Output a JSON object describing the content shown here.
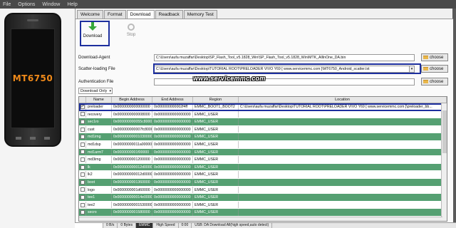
{
  "menu": [
    "File",
    "Options",
    "Window",
    "Help"
  ],
  "device_chip": "MT6750",
  "tabs": [
    "Welcome",
    "Format",
    "Download",
    "Readback",
    "Memory Test"
  ],
  "toolbar": {
    "download_label": "Download",
    "stop_label": "Stop"
  },
  "fields": {
    "download_agent_label": "Download-Agent",
    "download_agent_value": "C:\\Users\\aufa muzaffar\\Desktop\\SP_Flash_Tool_v5.1828_Win\\SP_Flash_Tool_v5.1828_Win\\MTK_AllInOne_DA.bin",
    "scatter_label": "Scatter-loading File",
    "scatter_value": "C:\\Users\\aufa muzaffar\\Desktop\\TUTORIAL ROOT\\PRELOADER VIVO Y69 [ www.servicemmc.com ]\\MT6750_Android_scatter.txt",
    "auth_label": "Authentication File",
    "auth_value": "",
    "choose": "choose"
  },
  "watermark": "www.servicemmc.com",
  "mode": "Download Only",
  "table": {
    "headers": [
      "",
      "Name",
      "Begin Address",
      "End Address",
      "Region",
      "Location"
    ],
    "rows": [
      {
        "checked": true,
        "name": "preloader",
        "begin": "0x0000000000000000",
        "end": "0x000000000002f4ff",
        "region": "EMMC_BOOT1_BOOT2",
        "location": "C:\\Users\\aufa muzaffar\\Desktop\\TUTORIAL ROOT\\PRELOADER VIVO Y69 [ www.servicemmc.com ]\\preloader_bb..."
      },
      {
        "checked": false,
        "name": "recovery",
        "begin": "0x0000000000008000",
        "end": "0x0000000000000000",
        "region": "EMMC_USER",
        "location": ""
      },
      {
        "checked": false,
        "name": "sec1ro",
        "begin": "0x000000000055c8000",
        "end": "0x0000000000000000",
        "region": "EMMC_USER",
        "location": ""
      },
      {
        "checked": false,
        "name": "cust",
        "begin": "0x000000000007fc8000",
        "end": "0x0000000000000000",
        "region": "EMMC_USER",
        "location": ""
      },
      {
        "checked": false,
        "name": "md1img",
        "begin": "0x0000000000103000000",
        "end": "0x0000000000000000",
        "region": "EMMC_USER",
        "location": ""
      },
      {
        "checked": false,
        "name": "md1dsp",
        "begin": "0x00000000011a00000",
        "end": "0x0000000000000000",
        "region": "EMMC_USER",
        "location": ""
      },
      {
        "checked": false,
        "name": "md1arm7",
        "begin": "0x0000000001f00000",
        "end": "0x0000000000000000",
        "region": "EMMC_USER",
        "location": ""
      },
      {
        "checked": false,
        "name": "md3img",
        "begin": "0x0000000001200000",
        "end": "0x0000000000000000",
        "region": "EMMC_USER",
        "location": ""
      },
      {
        "checked": false,
        "name": "lk",
        "begin": "0x000000000012d00000",
        "end": "0x0000000000000000",
        "region": "EMMC_USER",
        "location": ""
      },
      {
        "checked": false,
        "name": "lk2",
        "begin": "0x000000000012d00000",
        "end": "0x0000000000000000",
        "region": "EMMC_USER",
        "location": ""
      },
      {
        "checked": false,
        "name": "boot",
        "begin": "0x0000000001360000",
        "end": "0x0000000000000000",
        "region": "EMMC_USER",
        "location": ""
      },
      {
        "checked": false,
        "name": "logo",
        "begin": "0x0000000001d60000",
        "end": "0x0000000000000000",
        "region": "EMMC_USER",
        "location": ""
      },
      {
        "checked": false,
        "name": "tee1",
        "begin": "0x000000000014e00000",
        "end": "0x0000000000000000",
        "region": "EMMC_USER",
        "location": ""
      },
      {
        "checked": false,
        "name": "tee2",
        "begin": "0x0000000000153000000",
        "end": "0x0000000000000000",
        "region": "EMMC_USER",
        "location": ""
      },
      {
        "checked": false,
        "name": "secro",
        "begin": "0x0000000001580000",
        "end": "0x0000000000000000",
        "region": "EMMC_USER",
        "location": ""
      }
    ]
  },
  "status": {
    "speed": "0 B/s",
    "bytes": "0 Bytes",
    "storage": "EMMC",
    "mode": "High Speed",
    "time": "0:00",
    "message": "USB: DA Download All(high speed,auto detect)"
  },
  "colors": {
    "accent_box": "#1d2f9e",
    "row_green": "#55a072",
    "chip_text": "#f08a1a"
  }
}
